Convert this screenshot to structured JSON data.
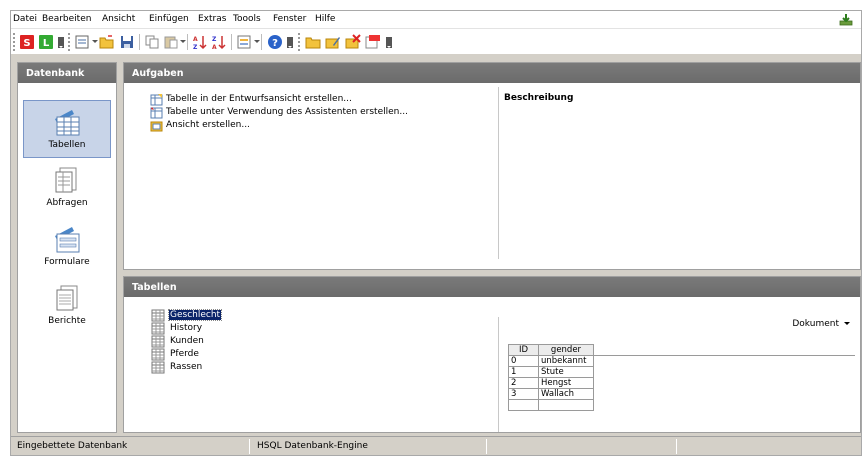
{
  "menu": [
    "Datei",
    "Bearbeiten",
    "Ansicht",
    "Einfügen",
    "Extras",
    "Toools",
    "Fenster",
    "Hilfe"
  ],
  "toolbar": {
    "icons": [
      "s-icon",
      "l-icon",
      "new-icon",
      "open-icon",
      "save-icon",
      "copy-icon",
      "paste-icon",
      "sort-ascending-icon",
      "sort-descending-icon",
      "form-icon",
      "help-icon",
      "folder-icon",
      "edit-icon",
      "delete-icon",
      "rename-icon"
    ]
  },
  "sidebar": {
    "title": "Datenbank",
    "items": [
      {
        "label": "Tabellen",
        "icon": "tables-icon",
        "active": true
      },
      {
        "label": "Abfragen",
        "icon": "queries-icon",
        "active": false
      },
      {
        "label": "Formulare",
        "icon": "forms-icon",
        "active": false
      },
      {
        "label": "Berichte",
        "icon": "reports-icon",
        "active": false
      }
    ]
  },
  "tasks": {
    "title": "Aufgaben",
    "links": [
      "Tabelle in der Entwurfsansicht erstellen...",
      "Tabelle unter Verwendung des Assistenten erstellen...",
      "Ansicht erstellen..."
    ],
    "description_title": "Beschreibung"
  },
  "tables": {
    "title": "Tabellen",
    "items": [
      "Geschlecht",
      "History",
      "Kunden",
      "Pferde",
      "Rassen"
    ],
    "selected": "Geschlecht",
    "preview_mode": "Dokument",
    "grid": {
      "columns": [
        "ID",
        "gender"
      ],
      "rows": [
        [
          "0",
          "unbekannt"
        ],
        [
          "1",
          "Stute"
        ],
        [
          "2",
          "Hengst"
        ],
        [
          "3",
          "Wallach"
        ]
      ]
    }
  },
  "status": {
    "left": "Eingebettete Datenbank",
    "middle": "HSQL Datenbank-Engine"
  },
  "colors": {
    "header_bg": "#6e6e6e",
    "selection": "#0a246a",
    "active_item": "#c8d4e8"
  }
}
